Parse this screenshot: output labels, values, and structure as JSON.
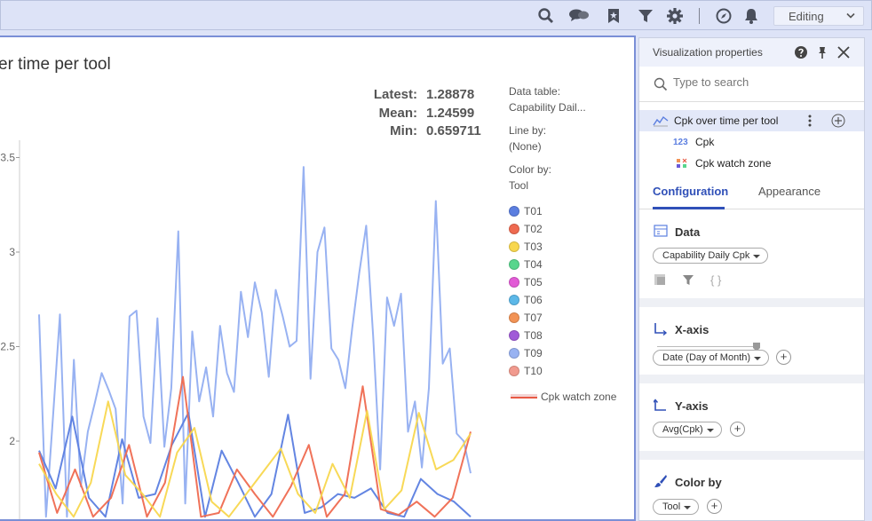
{
  "toolbar": {
    "mode": "Editing",
    "icons": [
      "search-icon",
      "comments-icon",
      "bookmark-icon",
      "filter-icon",
      "settings-icon",
      "compass-icon",
      "notifications-icon"
    ]
  },
  "viz": {
    "title": "er time per tool",
    "stats": [
      {
        "label": "Latest:",
        "value": "1.28878"
      },
      {
        "label": "Mean:",
        "value": "1.24599"
      },
      {
        "label": "Min:",
        "value": "0.659711"
      }
    ],
    "legend": {
      "data_table_label": "Data table:",
      "data_table_value": "Capability Dail...",
      "line_by_label": "Line by:",
      "line_by_value": "(None)",
      "color_by_label": "Color by:",
      "color_by_value": "Tool",
      "items": [
        {
          "name": "T01",
          "color": "#5b7ee0"
        },
        {
          "name": "T02",
          "color": "#ef6a50"
        },
        {
          "name": "T03",
          "color": "#f8d74e"
        },
        {
          "name": "T04",
          "color": "#58d68d"
        },
        {
          "name": "T05",
          "color": "#e25bd6"
        },
        {
          "name": "T06",
          "color": "#5cb8e8"
        },
        {
          "name": "T07",
          "color": "#f29355"
        },
        {
          "name": "T08",
          "color": "#a05ad8"
        },
        {
          "name": "T09",
          "color": "#98b2f2"
        },
        {
          "name": "T10",
          "color": "#f19a8e"
        }
      ],
      "zone_label": "Cpk watch zone"
    }
  },
  "chart_data": {
    "type": "line",
    "title": "er time per tool",
    "ylabel": "",
    "xlabel": "",
    "y_tick_labels": [
      "3.5",
      "3",
      "2.5",
      "2"
    ],
    "ylim": [
      1.6,
      3.6
    ],
    "series": [
      {
        "name": "T09",
        "values": [
          2.67,
          1.6,
          2.13,
          2.67,
          1.6,
          2.43,
          1.76,
          2.05,
          2.2,
          2.36,
          2.27,
          2.17,
          1.67,
          2.66,
          2.69,
          2.13,
          1.99,
          2.65,
          1.97,
          2.28,
          3.11,
          1.67,
          2.58,
          2.21,
          2.39,
          2.13,
          2.61,
          2.36,
          2.26,
          2.79,
          2.55,
          2.84,
          2.68,
          2.34,
          2.8,
          2.66,
          2.5,
          2.53,
          3.45,
          2.33,
          3.0,
          3.13,
          2.49,
          2.43,
          2.28,
          2.6,
          2.89,
          3.14,
          2.55,
          1.85,
          2.76,
          2.61,
          2.78,
          2.05,
          2.21,
          1.86,
          2.28,
          3.27,
          2.41,
          2.49,
          2.04,
          2.0,
          1.83
        ]
      },
      {
        "name": "T01",
        "values": [
          1.95,
          1.75,
          2.13,
          1.7,
          1.6,
          2.01,
          1.7,
          1.72,
          1.98,
          2.15,
          1.6,
          1.95,
          1.78,
          1.6,
          1.72,
          2.14,
          1.62,
          1.65,
          1.72,
          1.7,
          1.75,
          1.62,
          1.6,
          1.8,
          1.72,
          1.68,
          1.6
        ]
      },
      {
        "name": "T02",
        "values": [
          1.94,
          1.62,
          1.85,
          1.6,
          1.7,
          1.98,
          1.6,
          1.78,
          2.34,
          1.6,
          1.62,
          1.85,
          1.72,
          1.6,
          1.76,
          1.98,
          1.6,
          1.72,
          2.29,
          1.64,
          1.61,
          1.68,
          1.6,
          1.7,
          2.05
        ]
      },
      {
        "name": "T03",
        "values": [
          1.88,
          1.72,
          1.6,
          1.78,
          2.21,
          1.82,
          1.72,
          1.6,
          1.94,
          2.07,
          1.68,
          1.6,
          1.72,
          1.84,
          1.96,
          1.72,
          1.62,
          1.88,
          1.7,
          2.16,
          1.64,
          1.74,
          2.15,
          1.85,
          1.9,
          2.04
        ]
      }
    ]
  },
  "panel": {
    "title": "Visualization properties",
    "search_placeholder": "Type to search",
    "tree": [
      {
        "label": "Cpk over time per tool",
        "icon": "line-chart-icon"
      },
      {
        "label": "Cpk",
        "icon": "numeric-icon",
        "icon_text": "123"
      },
      {
        "label": "Cpk watch zone",
        "icon": "shapes-icon"
      }
    ],
    "tabs": [
      "Configuration",
      "Appearance"
    ],
    "sections": {
      "data": {
        "title": "Data",
        "chip": "Capability Daily Cpk"
      },
      "xaxis": {
        "title": "X-axis",
        "chip": "Date (Day of Month)"
      },
      "yaxis": {
        "title": "Y-axis",
        "chip": "Avg(Cpk)"
      },
      "colorby": {
        "title": "Color by",
        "chip": "Tool"
      }
    },
    "colors": {
      "accent": "#3050b8"
    }
  }
}
